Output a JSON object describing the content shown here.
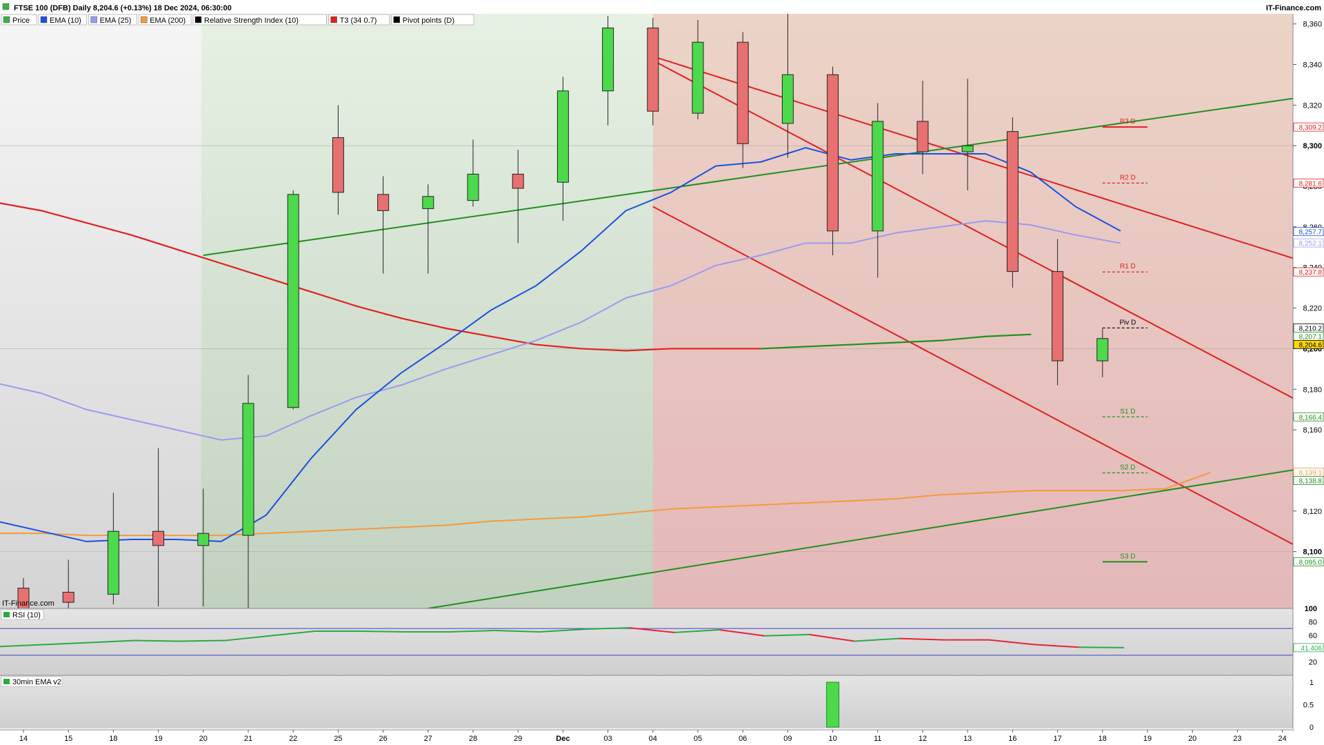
{
  "header": {
    "title": "FTSE 100 (DFB) Daily 8,204.6 (+0.13%) 18 Dec 2024, 06:30:00",
    "brand": "IT-Finance.com"
  },
  "legend": [
    {
      "label": "Price",
      "color": "#3cb043"
    },
    {
      "label": "EMA (10)",
      "color": "#1a4fe0"
    },
    {
      "label": "EMA (25)",
      "color": "#9a9af0"
    },
    {
      "label": "EMA (200)",
      "color": "#f39a3c"
    },
    {
      "label": "Relative Strength Index (10)",
      "color": "#000000"
    },
    {
      "label": "T3 (34 0.7)",
      "color": "#e02020"
    },
    {
      "label": "Pivot points (D)",
      "color": "#000000"
    }
  ],
  "watermark": "IT-Finance.com",
  "colors": {
    "up": "#4cd94c",
    "down": "#e87070",
    "ema10": "#1a4fe0",
    "ema25": "#9a9af0",
    "ema200": "#f39a3c",
    "t3_green": "#1f8f1f",
    "t3_red": "#e02020",
    "channel_red": "#e02020",
    "channel_green": "#1f8f1f",
    "rsi_up": "#2aa84a",
    "rsi_down": "#e8203c"
  },
  "chart_data": [
    {
      "type": "candlestick",
      "title": "FTSE 100 (DFB) Daily 8,204.6 (+0.13%) 18 Dec 2024, 06:30:00",
      "x_labels": [
        "14",
        "15",
        "18",
        "19",
        "20",
        "21",
        "22",
        "25",
        "26",
        "27",
        "28",
        "29",
        "Dec",
        "03",
        "04",
        "05",
        "06",
        "09",
        "10",
        "11",
        "12",
        "13",
        "16",
        "17",
        "18",
        "19",
        "20",
        "23",
        "24"
      ],
      "ylim": [
        8072,
        8365
      ],
      "y_ticks": [
        8100,
        8120,
        8140,
        8160,
        8180,
        8200,
        8220,
        8240,
        8260,
        8280,
        8300,
        8320,
        8340,
        8360
      ],
      "candles": [
        {
          "x": "14",
          "o": 8082,
          "h": 8087,
          "l": 8060,
          "c": 8070
        },
        {
          "x": "15",
          "o": 8080,
          "h": 8096,
          "l": 8060,
          "c": 8075
        },
        {
          "x": "18",
          "o": 8079,
          "h": 8129,
          "l": 8074,
          "c": 8110
        },
        {
          "x": "19",
          "o": 8110,
          "h": 8151,
          "l": 8073,
          "c": 8103
        },
        {
          "x": "20",
          "o": 8103,
          "h": 8131,
          "l": 8073,
          "c": 8109
        },
        {
          "x": "21",
          "o": 8108,
          "h": 8187,
          "l": 8072,
          "c": 8173
        },
        {
          "x": "22",
          "o": 8171,
          "h": 8278,
          "l": 8170,
          "c": 8276
        },
        {
          "x": "25",
          "o": 8304,
          "h": 8320,
          "l": 8266,
          "c": 8277
        },
        {
          "x": "26",
          "o": 8276,
          "h": 8285,
          "l": 8237,
          "c": 8268
        },
        {
          "x": "27",
          "o": 8269,
          "h": 8281,
          "l": 8237,
          "c": 8275
        },
        {
          "x": "28",
          "o": 8273,
          "h": 8303,
          "l": 8270,
          "c": 8286
        },
        {
          "x": "29",
          "o": 8286,
          "h": 8298,
          "l": 8252,
          "c": 8279
        },
        {
          "x": "Dec",
          "o": 8282,
          "h": 8334,
          "l": 8263,
          "c": 8327
        },
        {
          "x": "03",
          "o": 8327,
          "h": 8364,
          "l": 8310,
          "c": 8358
        },
        {
          "x": "04",
          "o": 8358,
          "h": 8363,
          "l": 8310,
          "c": 8317
        },
        {
          "x": "05",
          "o": 8316,
          "h": 8362,
          "l": 8313,
          "c": 8351
        },
        {
          "x": "06",
          "o": 8351,
          "h": 8356,
          "l": 8289,
          "c": 8301
        },
        {
          "x": "09",
          "o": 8311,
          "h": 8367,
          "l": 8294,
          "c": 8335
        },
        {
          "x": "10",
          "o": 8335,
          "h": 8339,
          "l": 8246,
          "c": 8258
        },
        {
          "x": "11",
          "o": 8258,
          "h": 8321,
          "l": 8235,
          "c": 8312
        },
        {
          "x": "12",
          "o": 8312,
          "h": 8332,
          "l": 8286,
          "c": 8297
        },
        {
          "x": "13",
          "o": 8297,
          "h": 8333,
          "l": 8278,
          "c": 8300
        },
        {
          "x": "16",
          "o": 8307,
          "h": 8314,
          "l": 8230,
          "c": 8238
        },
        {
          "x": "17",
          "o": 8238,
          "h": 8254,
          "l": 8182,
          "c": 8194
        },
        {
          "x": "18",
          "o": 8194,
          "h": 8210,
          "l": 8186,
          "c": 8205
        }
      ],
      "series": [
        {
          "name": "EMA (10)",
          "values": [
            8115,
            8110,
            8105,
            8106,
            8106,
            8105,
            8118,
            8146,
            8170,
            8188,
            8203,
            8219,
            8231,
            8248,
            8268,
            8277,
            8290,
            8292,
            8299,
            8293,
            8296,
            8296,
            8296,
            8287,
            8270,
            8258
          ]
        },
        {
          "name": "EMA (25)",
          "values": [
            8183,
            8178,
            8170,
            8165,
            8160,
            8155,
            8157,
            8167,
            8176,
            8182,
            8190,
            8197,
            8204,
            8213,
            8225,
            8231,
            8241,
            8246,
            8252,
            8252,
            8257,
            8260,
            8263,
            8261,
            8256,
            8252
          ]
        },
        {
          "name": "EMA (200)",
          "values": [
            8109,
            8109,
            8108,
            8108,
            8108,
            8108,
            8109,
            8110,
            8111,
            8112,
            8113,
            8115,
            8116,
            8117,
            8119,
            8121,
            8122,
            8123,
            8124,
            8125,
            8126,
            8128,
            8129,
            8130,
            8130,
            8130,
            8131,
            8139
          ]
        },
        {
          "name": "T3 (34 0.7)",
          "values": [
            8272,
            8268,
            8262,
            8256,
            8249,
            8242,
            8235,
            8228,
            8221,
            8215,
            8210,
            8206,
            8202,
            8200,
            8199,
            8200,
            8200,
            8200,
            8201,
            8202,
            8203,
            8204,
            8206,
            8207
          ]
        },
        {
          "name": "RSI (10)",
          "values": [
            43,
            46,
            49,
            52,
            51,
            52,
            59,
            66,
            66,
            65,
            65,
            67,
            65,
            69,
            71,
            64,
            68,
            59,
            61,
            51,
            55,
            53,
            53,
            46,
            42,
            41.4
          ]
        }
      ],
      "pivots": [
        {
          "label": "R3 D",
          "value": 8309.2
        },
        {
          "label": "R2 D",
          "value": 8281.6
        },
        {
          "label": "R1 D",
          "value": 8237.8
        },
        {
          "label": "Piv D",
          "value": 8210.2
        },
        {
          "label": "S1 D",
          "value": 8166.4
        },
        {
          "label": "S2 D",
          "value": 8138.8
        },
        {
          "label": "S3 D",
          "value": 8095.0
        }
      ],
      "price_tags": [
        {
          "text": "8,309.2",
          "value": 8309.2,
          "color": "#e02020"
        },
        {
          "text": "8,281.6",
          "value": 8281.6,
          "color": "#e02020"
        },
        {
          "text": "8,257.7",
          "value": 8257.7,
          "color": "#1a4fe0"
        },
        {
          "text": "8,252.1",
          "value": 8252.1,
          "color": "#9a9af0"
        },
        {
          "text": "8,237.8",
          "value": 8237.8,
          "color": "#e02020"
        },
        {
          "text": "8,210.2",
          "value": 8210.2,
          "color": "#000000"
        },
        {
          "text": "8,207.1",
          "value": 8207.1,
          "color": "#1f8f1f"
        },
        {
          "text": "8,204.6",
          "value": 8204.6,
          "color": "#000000",
          "highlight": "#ffd700"
        },
        {
          "text": "8,166.4",
          "value": 8166.4,
          "color": "#1f8f1f"
        },
        {
          "text": "8,139.1",
          "value": 8139.1,
          "color": "#f39a3c"
        },
        {
          "text": "8,138.8",
          "value": 8138.8,
          "color": "#1f8f1f"
        },
        {
          "text": "8,095.0",
          "value": 8095.0,
          "color": "#1f8f1f"
        }
      ],
      "trendlines": [
        {
          "name": "channel upper",
          "from": [
            "04",
            8344
          ],
          "to": [
            "24",
            8243
          ],
          "color": "red"
        },
        {
          "name": "channel middle",
          "from": [
            "04",
            8342
          ],
          "to": [
            "24",
            8173
          ],
          "color": "red"
        },
        {
          "name": "channel lower",
          "from": [
            "04",
            8270
          ],
          "to": [
            "24",
            8101
          ],
          "color": "red"
        },
        {
          "name": "support upper",
          "from": [
            "20",
            8246
          ],
          "to": [
            "24",
            8324
          ],
          "color": "green"
        },
        {
          "name": "support lower",
          "from": [
            "27",
            8072
          ],
          "to": [
            "24",
            8141
          ],
          "color": "green"
        }
      ]
    },
    {
      "type": "line",
      "title": "RSI (10)",
      "ylim": [
        0,
        100
      ],
      "y_ticks": [
        20,
        40,
        60,
        80,
        100
      ],
      "levels": [
        30,
        70
      ],
      "current": "41.406"
    },
    {
      "type": "bar",
      "title": "30min EMA v2",
      "ylim": [
        0,
        1
      ],
      "y_ticks": [
        "0",
        "0.5",
        "1"
      ],
      "bars": [
        {
          "x": "10",
          "value": 1
        }
      ]
    }
  ]
}
